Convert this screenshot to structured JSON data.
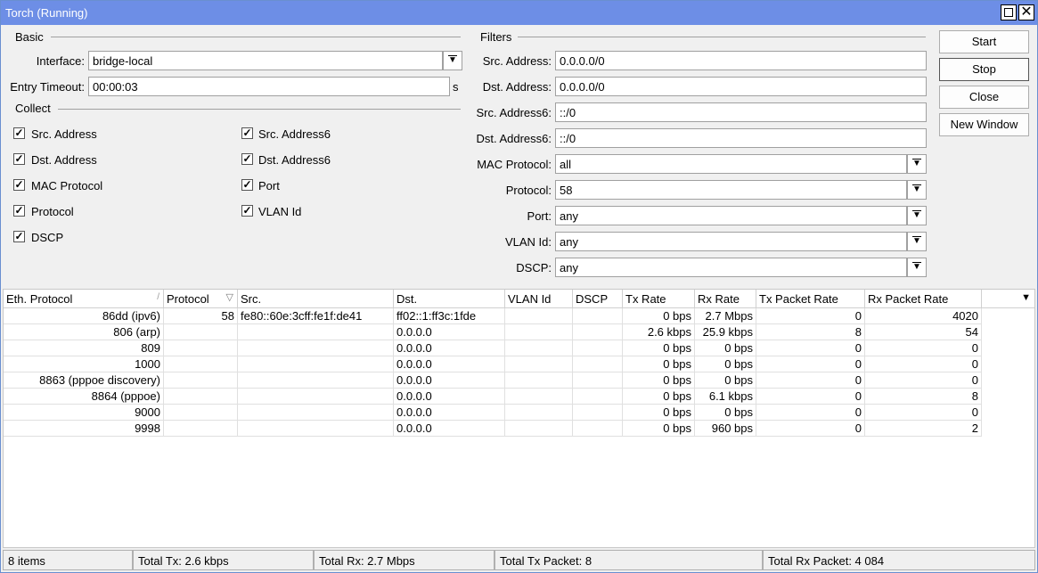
{
  "window": {
    "title": "Torch (Running)"
  },
  "basic": {
    "group_label": "Basic",
    "interface_label": "Interface:",
    "interface_value": "bridge-local",
    "entry_timeout_label": "Entry Timeout:",
    "entry_timeout_value": "00:00:03",
    "entry_timeout_unit": "s"
  },
  "collect": {
    "group_label": "Collect",
    "items": [
      {
        "label": "Src. Address",
        "checked": true
      },
      {
        "label": "Dst. Address",
        "checked": true
      },
      {
        "label": "MAC Protocol",
        "checked": true
      },
      {
        "label": "Protocol",
        "checked": true
      },
      {
        "label": "DSCP",
        "checked": true
      },
      {
        "label": "Src. Address6",
        "checked": true
      },
      {
        "label": "Dst. Address6",
        "checked": true
      },
      {
        "label": "Port",
        "checked": true
      },
      {
        "label": "VLAN Id",
        "checked": true
      }
    ]
  },
  "filters": {
    "group_label": "Filters",
    "rows": [
      {
        "label": "Src. Address:",
        "value": "0.0.0.0/0",
        "dropdown": false
      },
      {
        "label": "Dst. Address:",
        "value": "0.0.0.0/0",
        "dropdown": false
      },
      {
        "label": "Src. Address6:",
        "value": "::/0",
        "dropdown": false
      },
      {
        "label": "Dst. Address6:",
        "value": "::/0",
        "dropdown": false
      },
      {
        "label": "MAC Protocol:",
        "value": "all",
        "dropdown": true
      },
      {
        "label": "Protocol:",
        "value": "58",
        "dropdown": true
      },
      {
        "label": "Port:",
        "value": "any",
        "dropdown": true
      },
      {
        "label": "VLAN Id:",
        "value": "any",
        "dropdown": true
      },
      {
        "label": "DSCP:",
        "value": "any",
        "dropdown": true
      }
    ]
  },
  "buttons": {
    "start": "Start",
    "stop": "Stop",
    "close": "Close",
    "new_window": "New Window"
  },
  "table": {
    "columns": [
      "Eth. Protocol",
      "Protocol",
      "Src.",
      "Dst.",
      "VLAN Id",
      "DSCP",
      "Tx Rate",
      "Rx Rate",
      "Tx Packet Rate",
      "Rx Packet Rate"
    ],
    "rows": [
      [
        "86dd (ipv6)",
        "58",
        "fe80::60e:3cff:fe1f:de41",
        "ff02::1:ff3c:1fde",
        "",
        "",
        "0 bps",
        "2.7 Mbps",
        "0",
        "4020"
      ],
      [
        "806 (arp)",
        "",
        "",
        "0.0.0.0",
        "",
        "",
        "2.6 kbps",
        "25.9 kbps",
        "8",
        "54"
      ],
      [
        "809",
        "",
        "",
        "0.0.0.0",
        "",
        "",
        "0 bps",
        "0 bps",
        "0",
        "0"
      ],
      [
        "1000",
        "",
        "",
        "0.0.0.0",
        "",
        "",
        "0 bps",
        "0 bps",
        "0",
        "0"
      ],
      [
        "8863 (pppoe discovery)",
        "",
        "",
        "0.0.0.0",
        "",
        "",
        "0 bps",
        "0 bps",
        "0",
        "0"
      ],
      [
        "8864 (pppoe)",
        "",
        "",
        "0.0.0.0",
        "",
        "",
        "0 bps",
        "6.1 kbps",
        "0",
        "8"
      ],
      [
        "9000",
        "",
        "",
        "0.0.0.0",
        "",
        "",
        "0 bps",
        "0 bps",
        "0",
        "0"
      ],
      [
        "9998",
        "",
        "",
        "0.0.0.0",
        "",
        "",
        "0 bps",
        "960 bps",
        "0",
        "2"
      ]
    ]
  },
  "status": {
    "items": "8 items",
    "total_tx": "Total Tx: 2.6 kbps",
    "total_rx": "Total Rx: 2.7 Mbps",
    "total_tx_packet": "Total Tx Packet: 8",
    "total_rx_packet": "Total Rx Packet: 4 084"
  },
  "colors": {
    "titlebar": "#6d8ee6"
  }
}
